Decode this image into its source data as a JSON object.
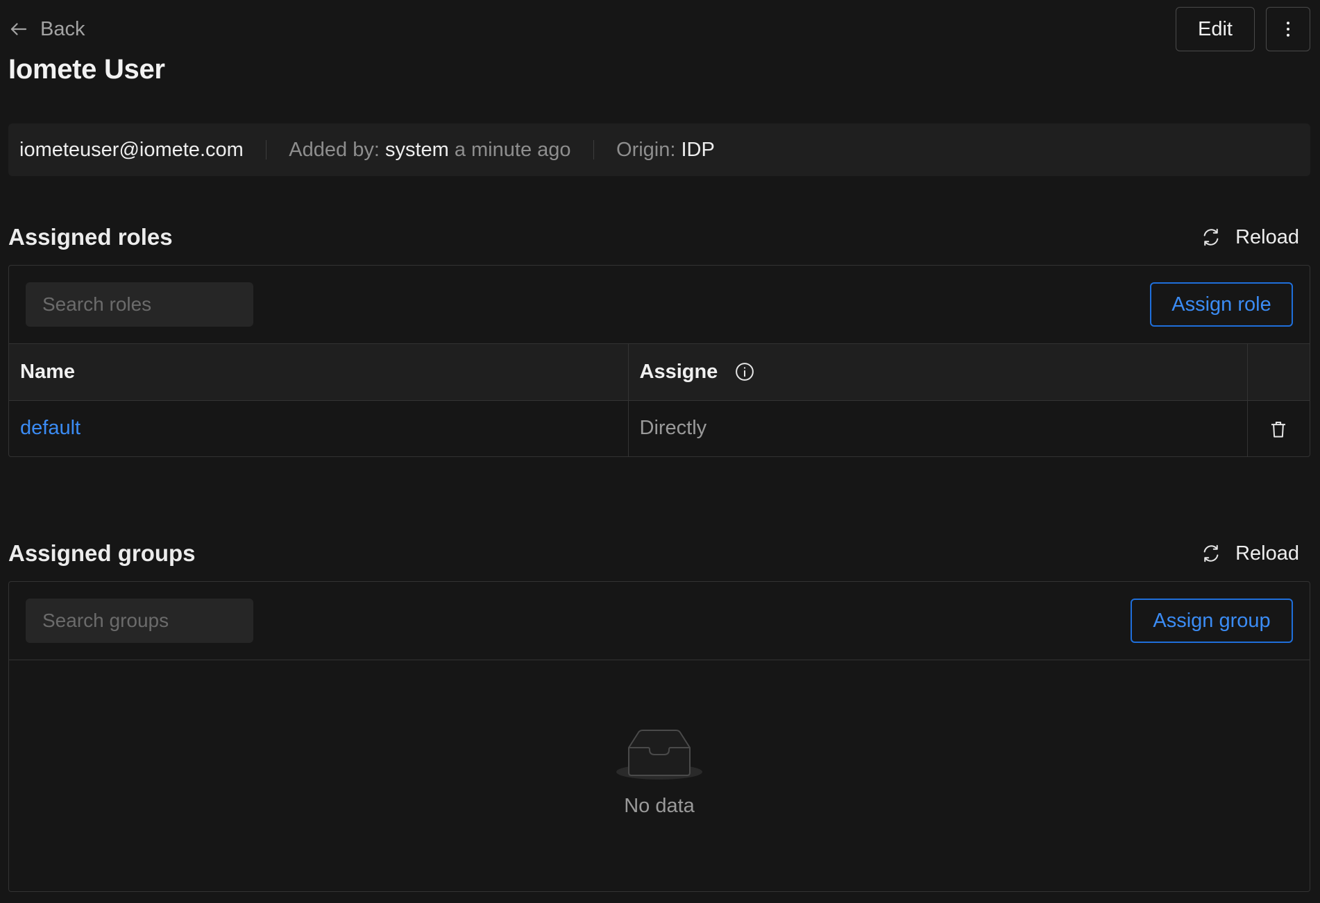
{
  "header": {
    "back_label": "Back",
    "edit_label": "Edit",
    "title": "Iomete User"
  },
  "info": {
    "email": "iometeuser@iomete.com",
    "added_by_label": "Added by: ",
    "added_by_value": "system",
    "added_time": " a minute ago",
    "origin_label": "Origin: ",
    "origin_value": "IDP"
  },
  "roles": {
    "title": "Assigned roles",
    "reload_label": "Reload",
    "search_placeholder": "Search roles",
    "assign_label": "Assign role",
    "columns": [
      "Name",
      "Assigne"
    ],
    "rows": [
      {
        "name": "default",
        "assign": "Directly"
      }
    ]
  },
  "groups": {
    "title": "Assigned groups",
    "reload_label": "Reload",
    "search_placeholder": "Search groups",
    "assign_label": "Assign group",
    "empty_text": "No data"
  },
  "colors": {
    "background": "#161616",
    "accent": "#3b8cf5"
  },
  "icons": [
    "arrow-left-icon",
    "more-vertical-icon",
    "reload-icon",
    "info-icon",
    "trash-icon",
    "empty-inbox-icon"
  ]
}
